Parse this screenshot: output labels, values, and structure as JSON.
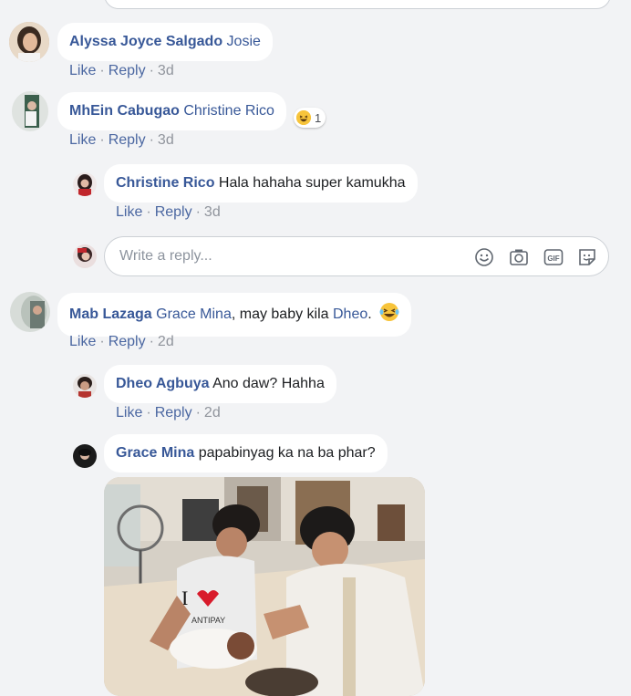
{
  "comments": [
    {
      "name": "Alyssa Joyce Salgado",
      "text_tag": "Josie",
      "actions": {
        "like": "Like",
        "reply": "Reply",
        "time": "3d"
      }
    },
    {
      "name": "MhEin Cabugao",
      "text_tag": "Christine Rico",
      "reaction_count": "1",
      "actions": {
        "like": "Like",
        "reply": "Reply",
        "time": "3d"
      }
    },
    {
      "name": "Christine Rico",
      "text": "Hala hahaha super kamukha",
      "actions": {
        "like": "Like",
        "reply": "Reply",
        "time": "3d"
      }
    },
    {
      "name": "Mab Lazaga",
      "tag1": "Grace Mina",
      "text_mid": ", may baby kila ",
      "tag2": "Dheo",
      "text_end": ".",
      "actions": {
        "like": "Like",
        "reply": "Reply",
        "time": "2d"
      }
    },
    {
      "name": "Dheo Agbuya",
      "text": "Ano daw? Hahha",
      "actions": {
        "like": "Like",
        "reply": "Reply",
        "time": "2d"
      }
    },
    {
      "name": "Grace Mina",
      "text": "papabinyag ka na ba phar?"
    }
  ],
  "reply_box": {
    "placeholder": "Write a reply..."
  },
  "separator": "·",
  "photo_shirt_text": "I",
  "photo_shirt_sub": "ANTIPAY",
  "icons": [
    "emoji-icon",
    "camera-icon",
    "gif-icon",
    "sticker-icon"
  ],
  "colors": {
    "name": "#385898",
    "link": "#4b67a1",
    "meta": "#90949c",
    "bg": "#f2f3f5"
  }
}
